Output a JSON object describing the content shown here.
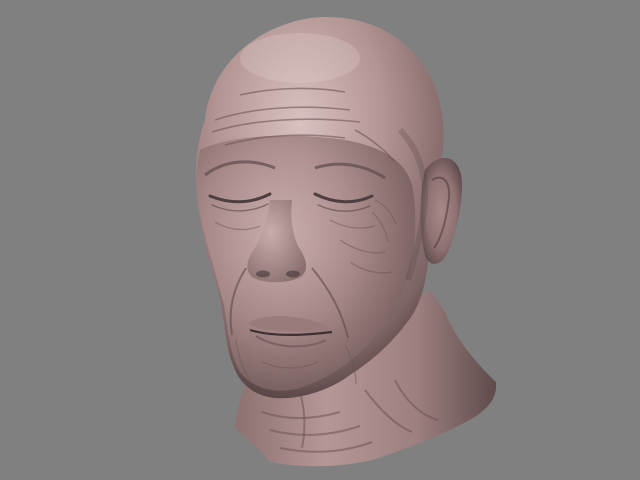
{
  "viewport": {
    "background_color": "#808080"
  },
  "model": {
    "subject": "sculpted-elderly-head",
    "material_color": "#b79a99",
    "shadow_color": "#5e4a4b",
    "highlight_color": "#dcc4c3",
    "eyes": "closed",
    "mesh_style": "wrinkled-skin"
  }
}
